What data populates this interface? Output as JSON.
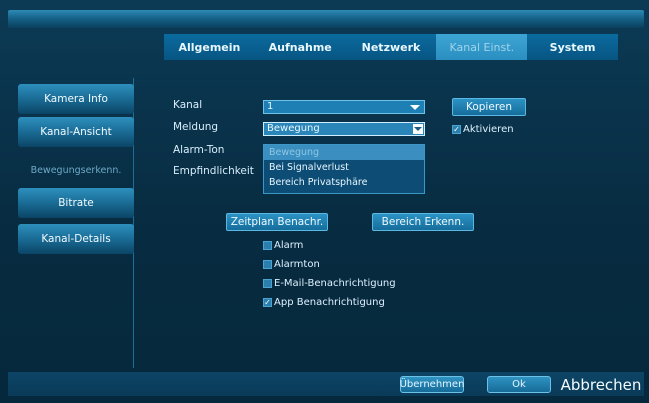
{
  "tabs": [
    {
      "label": "Allgemein"
    },
    {
      "label": "Aufnahme"
    },
    {
      "label": "Netzwerk"
    },
    {
      "label": "Kanal Einst."
    },
    {
      "label": "System"
    }
  ],
  "sidebar": {
    "items": [
      {
        "label": "Kamera Info"
      },
      {
        "label": "Kanal-Ansicht"
      },
      {
        "label": "Bewegungserkenn."
      },
      {
        "label": "Bitrate"
      },
      {
        "label": "Kanal-Details"
      }
    ]
  },
  "form": {
    "kanal_label": "Kanal",
    "kanal_value": "1",
    "meldung_label": "Meldung",
    "meldung_value": "Bewegung",
    "alarm_ton_label": "Alarm-Ton",
    "empfindlichkeit_label": "Empfindlichkeit",
    "copy_button": "Kopieren",
    "activate_label": "Aktivieren",
    "dropdown_options": [
      "Bewegung",
      "Bei Signalverlust",
      "Bereich Privatsphäre"
    ],
    "schedule_button": "Zeitplan Benachr.",
    "area_button": "Bereich Erkenn.",
    "checkboxes": [
      {
        "label": "Alarm",
        "checked": false
      },
      {
        "label": "Alarmton",
        "checked": false
      },
      {
        "label": "E-Mail-Benachrichtigung",
        "checked": false
      },
      {
        "label": "App Benachrichtigung",
        "checked": true
      }
    ]
  },
  "footer": {
    "apply": "Übernehmen",
    "ok": "Ok",
    "cancel": "Abbrechen"
  }
}
